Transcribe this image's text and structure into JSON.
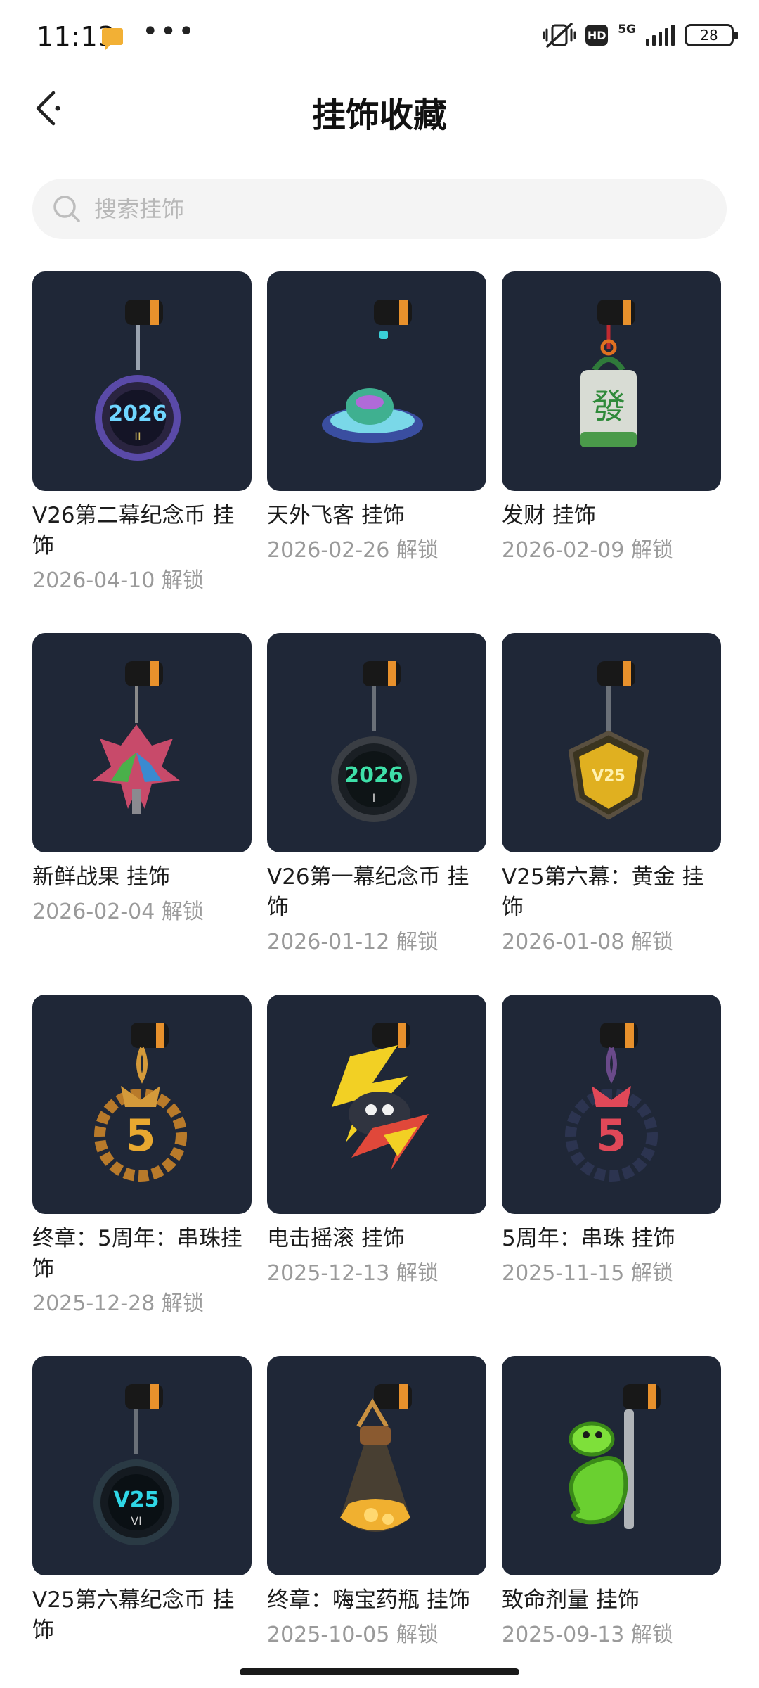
{
  "status_bar": {
    "time": "11:13",
    "dots": "•••",
    "hd": "HD",
    "network": "5G",
    "battery": "28"
  },
  "header": {
    "title": "挂饰收藏"
  },
  "search": {
    "placeholder": "搜索挂饰",
    "value": ""
  },
  "items": [
    {
      "name": "V26第二幕纪念币 挂饰",
      "date": "2026-04-10 解锁",
      "icon": "coin-2026-ii-icon",
      "accent": "#7b5cff"
    },
    {
      "name": "天外飞客 挂饰",
      "date": "2026-02-26 解锁",
      "icon": "ufo-icon",
      "accent": "#3ad0d8"
    },
    {
      "name": "发财 挂饰",
      "date": "2026-02-09 解锁",
      "icon": "mahjong-tile-icon",
      "accent": "#2f8a3a"
    },
    {
      "name": "新鲜战果 挂饰",
      "date": "2026-02-04 解锁",
      "icon": "maple-leaf-icon",
      "accent": "#d94848"
    },
    {
      "name": "V26第一幕纪念币 挂饰",
      "date": "2026-01-12 解锁",
      "icon": "coin-2026-i-icon",
      "accent": "#2ecf96"
    },
    {
      "name": "V25第六幕：黄金 挂饰",
      "date": "2026-01-08 解锁",
      "icon": "gold-badge-icon",
      "accent": "#e0b020"
    },
    {
      "name": "终章：5周年：串珠挂饰",
      "date": "2025-12-28 解锁",
      "icon": "bead-ring-gold-icon",
      "accent": "#d49a3a"
    },
    {
      "name": "电击摇滚 挂饰",
      "date": "2025-12-13 解锁",
      "icon": "lightning-icon",
      "accent": "#f2d024"
    },
    {
      "name": "5周年：串珠 挂饰",
      "date": "2025-11-15 解锁",
      "icon": "bead-ring-red-icon",
      "accent": "#e04858"
    },
    {
      "name": "V25第六幕纪念币 挂饰",
      "date": "",
      "icon": "coin-v25-vi-icon",
      "accent": "#2fd6e6"
    },
    {
      "name": "终章：嗨宝药瓶 挂饰",
      "date": "2025-10-05 解锁",
      "icon": "potion-bottle-icon",
      "accent": "#f0b030"
    },
    {
      "name": "致命剂量 挂饰",
      "date": "2025-09-13 解锁",
      "icon": "snake-icon",
      "accent": "#7ee03a"
    }
  ]
}
